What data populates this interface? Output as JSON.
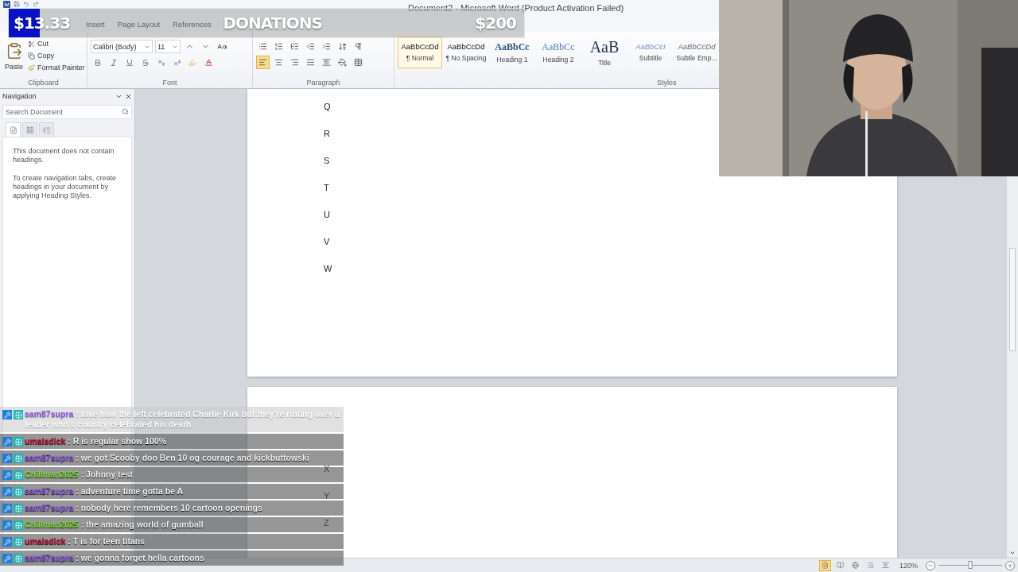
{
  "title_bar": {
    "title": "Document2 - Microsoft Word (Product Activation Failed)"
  },
  "ribbon_tabs": [
    {
      "label": "Insert"
    },
    {
      "label": "Page Layout"
    },
    {
      "label": "References"
    }
  ],
  "ribbon": {
    "clipboard": {
      "label": "Clipboard",
      "paste": "Paste",
      "cut": "Cut",
      "copy": "Copy",
      "format_painter": "Format Painter"
    },
    "font": {
      "label": "Font",
      "font_name": "Calibri (Body)",
      "font_size": "11"
    },
    "paragraph": {
      "label": "Paragraph",
      "alignments": [
        {
          "kind": "left",
          "selected": true
        },
        {
          "kind": "center",
          "selected": false
        },
        {
          "kind": "right",
          "selected": false
        },
        {
          "kind": "justify",
          "selected": false
        }
      ]
    },
    "styles": {
      "label": "Styles",
      "items": [
        {
          "kind": "normal",
          "preview": "AaBbCcDd",
          "name": "¶ Normal",
          "selected": true
        },
        {
          "kind": "normal",
          "preview": "AaBbCcDd",
          "name": "¶ No Spacing",
          "selected": false
        },
        {
          "kind": "heading1",
          "preview": "AaBbCc",
          "name": "Heading 1",
          "selected": false
        },
        {
          "kind": "heading2",
          "preview": "AaBbCc",
          "name": "Heading 2",
          "selected": false
        },
        {
          "kind": "title",
          "preview": "AaB",
          "name": "Title",
          "selected": false
        },
        {
          "kind": "subtitle",
          "preview": "AaBbCcI",
          "name": "Subtitle",
          "selected": false
        },
        {
          "kind": "subtle",
          "preview": "AaBbCcDd",
          "name": "Subtle Emp...",
          "selected": false
        }
      ]
    }
  },
  "navigation": {
    "title": "Navigation",
    "search": {
      "placeholder": "Search Document"
    },
    "tabs": [
      {
        "kind": "headings",
        "selected": true
      },
      {
        "kind": "pages",
        "selected": false
      },
      {
        "kind": "results",
        "selected": false
      }
    ],
    "messages": [
      "This document does not contain headings.",
      "To create navigation tabs, create headings in your document by applying Heading Styles."
    ]
  },
  "document": {
    "pages": [
      {
        "paragraphs": [
          "Q",
          "R",
          "S",
          "T",
          "U",
          "V",
          "W"
        ]
      },
      {
        "paragraphs": [
          "X",
          "Y",
          "Z"
        ]
      }
    ]
  },
  "status_bar": {
    "views": [
      {
        "kind": "print",
        "selected": true
      },
      {
        "kind": "reading",
        "selected": false
      },
      {
        "kind": "web",
        "selected": false
      },
      {
        "kind": "outline",
        "selected": false
      },
      {
        "kind": "draft",
        "selected": false
      }
    ],
    "zoom": "120%",
    "zoom_slider": {
      "level": 0.5
    }
  },
  "donations": {
    "amount": "$13.33",
    "title": "DONATIONS",
    "goal": "$200",
    "level": 0.06
  },
  "chat": {
    "messages": [
      {
        "user": "sam87supra",
        "color": "#8a55e0",
        "text": ": love how the left celebrated Charlie Kirk but they're rioting over a leader who's country celebrated his death",
        "faded": true
      },
      {
        "user": "umaisdick",
        "color": "#c0143c",
        "text": ": R is regular show 100%",
        "faded": false
      },
      {
        "user": "sam87supra",
        "color": "#8a55e0",
        "text": ": we got Scooby doo Ben 10 og courage and kickbuttowski",
        "faded": false
      },
      {
        "user": "Chillman2025",
        "color": "#7ae52a",
        "text": ": Johnny test",
        "faded": false
      },
      {
        "user": "sam87supra",
        "color": "#8a55e0",
        "text": ": adventure time gotta be A",
        "faded": false
      },
      {
        "user": "sam87supra",
        "color": "#8a55e0",
        "text": ": nobody here remembers 10 cartoon openings",
        "faded": false
      },
      {
        "user": "Chillman2025",
        "color": "#7ae52a",
        "text": ": the amazing world of gumball",
        "faded": false
      },
      {
        "user": "umaisdick",
        "color": "#c0143c",
        "text": ": T is for teen titans",
        "faded": false
      },
      {
        "user": "sam87supra",
        "color": "#8a55e0",
        "text": ": we gonna forget hella cartoons",
        "faded": false
      }
    ]
  }
}
